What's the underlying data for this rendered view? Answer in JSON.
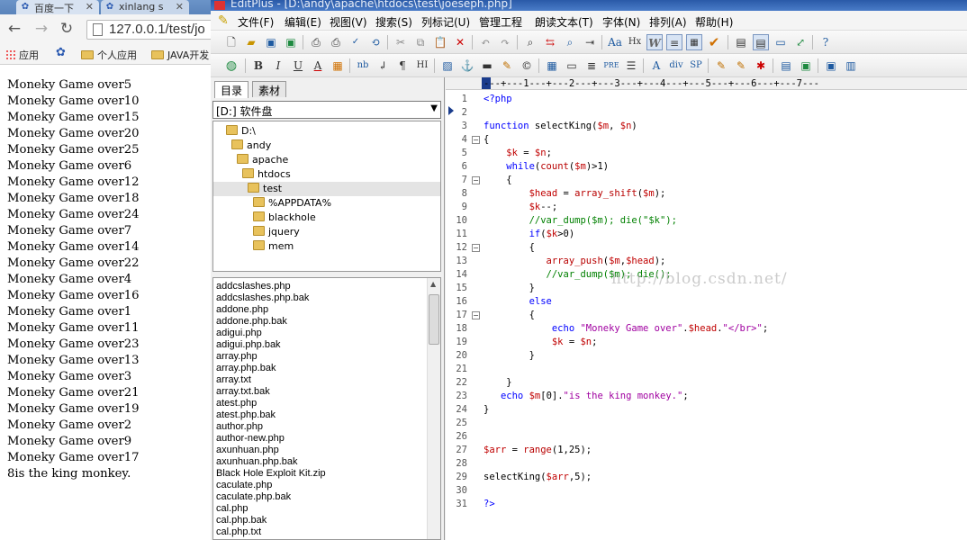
{
  "browser": {
    "tabs": [
      {
        "label": "百度一下",
        "favicon": "paw-icon"
      },
      {
        "label": "xinlang s",
        "favicon": "paw-icon"
      }
    ],
    "url": "127.0.0.1/test/jo",
    "bookmarks": [
      {
        "label": "应用",
        "icon": "apps-grid-icon"
      },
      {
        "label": "",
        "icon": "paw-icon"
      },
      {
        "label": "个人应用",
        "icon": "folder-icon"
      },
      {
        "label": "JAVA开发",
        "icon": "folder-icon"
      }
    ],
    "output_lines": [
      "Moneky Game over5",
      "Moneky Game over10",
      "Moneky Game over15",
      "Moneky Game over20",
      "Moneky Game over25",
      "Moneky Game over6",
      "Moneky Game over12",
      "Moneky Game over18",
      "Moneky Game over24",
      "Moneky Game over7",
      "Moneky Game over14",
      "Moneky Game over22",
      "Moneky Game over4",
      "Moneky Game over16",
      "Moneky Game over1",
      "Moneky Game over11",
      "Moneky Game over23",
      "Moneky Game over13",
      "Moneky Game over3",
      "Moneky Game over21",
      "Moneky Game over19",
      "Moneky Game over2",
      "Moneky Game over9",
      "Moneky Game over17",
      "8is the king monkey."
    ]
  },
  "editor": {
    "title": "EditPlus - [D:\\andy\\apache\\htdocs\\test\\joeseph.php]",
    "menus": [
      "文件(F)",
      "编辑(E)",
      "视图(V)",
      "搜索(S)",
      "列标记(U)",
      "管理工程",
      "朗读文本(T)",
      "字体(N)",
      "排列(A)",
      "帮助(H)"
    ],
    "toolbar2_labels": {
      "nb": "nb",
      "pre": "PRE",
      "div": "div",
      "sp": "SP",
      "hx": "Hx",
      "hi": "HI"
    },
    "panel_tabs": [
      "目录",
      "素材"
    ],
    "drive": "[D:] 软件盘",
    "tree": [
      "D:\\",
      "andy",
      "apache",
      "htdocs",
      "test",
      "%APPDATA%",
      "blackhole",
      "jquery",
      "mem"
    ],
    "files": [
      "addcslashes.php",
      "addcslashes.php.bak",
      "addone.php",
      "addone.php.bak",
      "adigui.php",
      "adigui.php.bak",
      "array.php",
      "array.php.bak",
      "array.txt",
      "array.txt.bak",
      "atest.php",
      "atest.php.bak",
      "author.php",
      "author-new.php",
      "axunhuan.php",
      "axunhuan.php.bak",
      "Black Hole Exploit Kit.zip",
      "caculate.php",
      "caculate.php.bak",
      "cal.php",
      "cal.php.bak",
      "cal.php.txt"
    ],
    "ruler": "---+---1---+---2---+---3---+---4---+---5---+---6---+---7---",
    "watermark": "http://blog.csdn.net/",
    "code_lines": [
      [
        [
          "k",
          "<?php"
        ]
      ],
      [],
      [
        [
          "k",
          "function"
        ],
        [
          "p",
          " selectKing("
        ],
        [
          "v",
          "$m"
        ],
        [
          "p",
          ", "
        ],
        [
          "v",
          "$n"
        ],
        [
          "p",
          ")"
        ]
      ],
      [
        [
          "p",
          "{"
        ]
      ],
      [
        [
          "p",
          "    "
        ],
        [
          "v",
          "$k"
        ],
        [
          "p",
          " = "
        ],
        [
          "v",
          "$n"
        ],
        [
          "p",
          ";"
        ]
      ],
      [
        [
          "p",
          "    "
        ],
        [
          "k",
          "while"
        ],
        [
          "p",
          "("
        ],
        [
          "f",
          "count"
        ],
        [
          "p",
          "("
        ],
        [
          "v",
          "$m"
        ],
        [
          "p",
          ")>1)"
        ]
      ],
      [
        [
          "p",
          "    {"
        ]
      ],
      [
        [
          "p",
          "        "
        ],
        [
          "v",
          "$head"
        ],
        [
          "p",
          " = "
        ],
        [
          "f",
          "array_shift"
        ],
        [
          "p",
          "("
        ],
        [
          "v",
          "$m"
        ],
        [
          "p",
          ");"
        ]
      ],
      [
        [
          "p",
          "        "
        ],
        [
          "v",
          "$k"
        ],
        [
          "p",
          "--;"
        ]
      ],
      [
        [
          "c",
          "        //var_dump($m); die(\"$k\");"
        ]
      ],
      [
        [
          "p",
          "        "
        ],
        [
          "k",
          "if"
        ],
        [
          "p",
          "("
        ],
        [
          "v",
          "$k"
        ],
        [
          "p",
          ">0)"
        ]
      ],
      [
        [
          "p",
          "        {"
        ]
      ],
      [
        [
          "p",
          "           "
        ],
        [
          "f",
          "array_push"
        ],
        [
          "p",
          "("
        ],
        [
          "v",
          "$m"
        ],
        [
          "p",
          ","
        ],
        [
          "v",
          "$head"
        ],
        [
          "p",
          ");"
        ]
      ],
      [
        [
          "c",
          "           //var_dump($m); die();"
        ]
      ],
      [
        [
          "p",
          "        }"
        ]
      ],
      [
        [
          "p",
          "        "
        ],
        [
          "k",
          "else"
        ]
      ],
      [
        [
          "p",
          "        {"
        ]
      ],
      [
        [
          "p",
          "            "
        ],
        [
          "k",
          "echo"
        ],
        [
          "p",
          " "
        ],
        [
          "s",
          "\"Moneky Game over\""
        ],
        [
          "p",
          "."
        ],
        [
          "v",
          "$head"
        ],
        [
          "p",
          "."
        ],
        [
          "s",
          "\"</br>\""
        ],
        [
          "p",
          ";"
        ]
      ],
      [
        [
          "p",
          "            "
        ],
        [
          "v",
          "$k"
        ],
        [
          "p",
          " = "
        ],
        [
          "v",
          "$n"
        ],
        [
          "p",
          ";"
        ]
      ],
      [
        [
          "p",
          "        }"
        ]
      ],
      [],
      [
        [
          "p",
          "    }"
        ]
      ],
      [
        [
          "p",
          "   "
        ],
        [
          "k",
          "echo"
        ],
        [
          "p",
          " "
        ],
        [
          "v",
          "$m"
        ],
        [
          "p",
          "[0]."
        ],
        [
          "s",
          "\"is the king monkey.\""
        ],
        [
          "p",
          ";"
        ]
      ],
      [
        [
          "p",
          "}"
        ]
      ],
      [],
      [],
      [
        [
          "v",
          "$arr"
        ],
        [
          "p",
          " = "
        ],
        [
          "f",
          "range"
        ],
        [
          "p",
          "(1,25);"
        ]
      ],
      [],
      [
        [
          "p",
          "selectKing("
        ],
        [
          "v",
          "$arr"
        ],
        [
          "p",
          ",5);"
        ]
      ],
      [],
      [
        [
          "k",
          "?>"
        ]
      ]
    ]
  }
}
